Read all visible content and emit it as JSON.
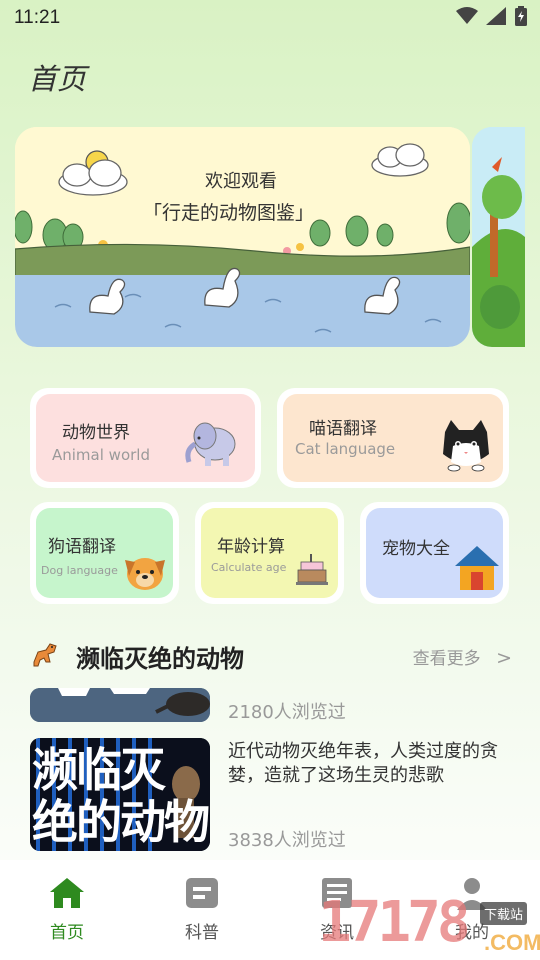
{
  "status_bar": {
    "time": "11:21"
  },
  "header": {
    "title": "首页"
  },
  "banner": {
    "line1": "欢迎观看",
    "line2": "「行走的动物图鉴」"
  },
  "categories": [
    {
      "title": "动物世界",
      "subtitle": "Animal world",
      "color": "#fde0df"
    },
    {
      "title": "喵语翻译",
      "subtitle": "Cat language",
      "color": "#fde6cf"
    },
    {
      "title": "狗语翻译",
      "subtitle": "Dog language",
      "color": "#c6f5cc"
    },
    {
      "title": "年龄计算",
      "subtitle": "Calculate age",
      "color": "#f3f7b2"
    },
    {
      "title": "宠物大全",
      "subtitle": "",
      "color": "#cfdcfb"
    }
  ],
  "section": {
    "title": "濒临灭绝的动物",
    "more": "查看更多",
    "more_arrow": ">"
  },
  "articles": [
    {
      "views": "2180人浏览过"
    },
    {
      "thumb_line1": "濒临灭",
      "thumb_line2": "绝的动物",
      "desc": "近代动物灭绝年表，人类过度的贪婪，造就了这场生灵的悲歌",
      "views": "3838人浏览过"
    }
  ],
  "bottom_nav": [
    {
      "label": "首页",
      "icon": "home-icon",
      "active": true
    },
    {
      "label": "科普",
      "icon": "book-icon",
      "active": false
    },
    {
      "label": "资讯",
      "icon": "news-icon",
      "active": false
    },
    {
      "label": "我的",
      "icon": "profile-icon",
      "active": false
    }
  ],
  "watermark": {
    "number": "17178",
    "suffix": ".COM",
    "tag": "下载站"
  },
  "colors": {
    "accent": "#2e8a1f",
    "background": "#e4f5d6"
  }
}
